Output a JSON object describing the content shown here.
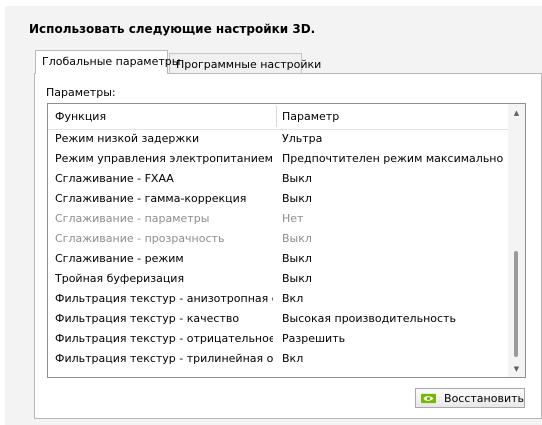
{
  "heading": "Использовать следующие настройки 3D.",
  "tabs": [
    {
      "label": "Глобальные параметры",
      "active": true
    },
    {
      "label": "Программные настройки",
      "active": false
    }
  ],
  "params_label": "Параметры:",
  "columns": {
    "function": "Функция",
    "parameter": "Параметр"
  },
  "rows": [
    {
      "function": "Режим низкой задержки",
      "value": "Ультра",
      "disabled": false
    },
    {
      "function": "Режим управления электропитанием",
      "value": "Предпочтителен режим максимальной п...",
      "disabled": false
    },
    {
      "function": "Сглаживание - FXAA",
      "value": "Выкл",
      "disabled": false
    },
    {
      "function": "Сглаживание - гамма-коррекция",
      "value": "Выкл",
      "disabled": false
    },
    {
      "function": "Сглаживание - параметры",
      "value": "Нет",
      "disabled": true
    },
    {
      "function": "Сглаживание - прозрачность",
      "value": "Выкл",
      "disabled": true
    },
    {
      "function": "Сглаживание - режим",
      "value": "Выкл",
      "disabled": false
    },
    {
      "function": "Тройная буферизация",
      "value": "Выкл",
      "disabled": false
    },
    {
      "function": "Фильтрация текстур - анизотропная оп...",
      "value": "Вкл",
      "disabled": false
    },
    {
      "function": "Фильтрация текстур - качество",
      "value": "Высокая производительность",
      "disabled": false
    },
    {
      "function": "Фильтрация текстур - отрицательное о...",
      "value": "Разрешить",
      "disabled": false
    },
    {
      "function": "Фильтрация текстур - трилинейная опт...",
      "value": "Вкл",
      "disabled": false
    }
  ],
  "restore_button": "Восстановить",
  "icons": {
    "button_icon": "nvidia-logo-icon",
    "scroll_up": "arrow-up-icon",
    "scroll_down": "arrow-down-icon"
  },
  "colors": {
    "disabled_text": "#8d8d8d",
    "nvidia_green": "#76b900"
  }
}
